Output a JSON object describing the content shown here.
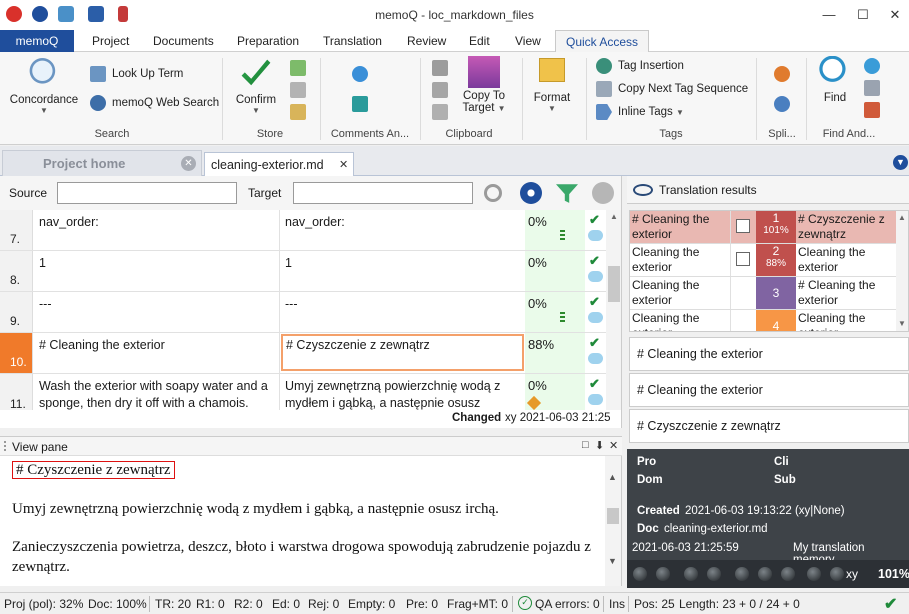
{
  "window": {
    "title": "memoQ - loc_markdown_files",
    "controls": [
      "—",
      "☐",
      "✕"
    ]
  },
  "ribbon_tabs": [
    "memoQ",
    "Project",
    "Documents",
    "Preparation",
    "Translation",
    "Review",
    "Edit",
    "View",
    "Quick Access"
  ],
  "ribbon": {
    "search": {
      "concordance": "Concordance",
      "look_up_term": "Look Up Term",
      "web_search": "memoQ Web Search",
      "label": "Search"
    },
    "store": {
      "confirm": "Confirm",
      "label": "Store"
    },
    "comments": {
      "label": "Comments An..."
    },
    "clipboard": {
      "copy_to_target_1": "Copy To",
      "copy_to_target_2": "Target",
      "label": "Clipboard"
    },
    "format": {
      "format": "Format"
    },
    "tags": {
      "tag_insertion": "Tag Insertion",
      "copy_next_tag": "Copy Next Tag Sequence",
      "inline_tags": "Inline Tags",
      "label": "Tags"
    },
    "split": {
      "label": "Spli..."
    },
    "find": {
      "find": "Find",
      "label": "Find And..."
    }
  },
  "doc_tabs": {
    "home": "Project home",
    "document": "cleaning-exterior.md"
  },
  "filter": {
    "source_label": "Source",
    "target_label": "Target",
    "source_value": "",
    "target_value": ""
  },
  "grid": {
    "rows": [
      {
        "num": "7.",
        "source": "nav_order:",
        "target": "nav_order:",
        "match": "0%"
      },
      {
        "num": "8.",
        "source": "1",
        "target": "1",
        "match": "0%"
      },
      {
        "num": "9.",
        "source": "---",
        "target": "---",
        "match": "0%"
      },
      {
        "num": "10.",
        "source": "# Cleaning the exterior",
        "target": "# Czyszczenie z zewnątrz",
        "match": "88%"
      },
      {
        "num": "11.",
        "source": "Wash the exterior with soapy water and a sponge, then dry it off with a chamois.",
        "target": "Umyj zewnętrzną powierzchnię wodą z mydłem i gąbką, a następnie osusz",
        "match": "0%"
      }
    ],
    "changed_label": "Changed",
    "changed_info": "xy 2021-06-03 21:25"
  },
  "view_pane": {
    "title": "View pane",
    "controls": [
      "□",
      "⬇",
      "✕"
    ],
    "current": "# Czyszczenie z zewnątrz",
    "para1": "Umyj zewnętrzną powierzchnię wodą z mydłem i gąbką, a następnie osusz irchą.",
    "para2": "Zanieczyszczenia powietrza, deszcz, błoto i warstwa drogowa spowodują zabrudzenie pojazdu z zewnątrz."
  },
  "translation_results": {
    "title": "Translation results",
    "hits": [
      {
        "source": "# Cleaning the exterior",
        "num": "1",
        "pct": "101%",
        "target": "# Czyszczenie z zewnątrz",
        "color": "#c0504d"
      },
      {
        "source": "Cleaning the exterior",
        "num": "2",
        "pct": "88%",
        "target": "Cleaning the exterior",
        "color": "#c0504d"
      },
      {
        "source": "Cleaning the exterior",
        "num": "3",
        "pct": "",
        "target": "# Cleaning the exterior",
        "color": "#8064a2"
      },
      {
        "source": "Cleaning the exterior",
        "num": "4",
        "pct": "",
        "target": "Cleaning the exterior",
        "color": "#f79646"
      }
    ],
    "compare_source": "# Cleaning the exterior",
    "compare_match": "# Cleaning the exterior",
    "compare_target": "# Czyszczenie z zewnątrz"
  },
  "info_panel": {
    "pro": "Pro",
    "cli": "Cli",
    "dom": "Dom",
    "sub": "Sub",
    "created_label": "Created",
    "created_value": "2021-06-03 19:13:22 (xy|None)",
    "doc_label": "Doc",
    "doc_value": "cleaning-exterior.md",
    "modified": "2021-06-03 21:25:59",
    "tm_name": "My translation memory",
    "user": "xy",
    "percent": "101%"
  },
  "status_bar": {
    "proj": "Proj (pol): 32%",
    "doc": "Doc: 100%",
    "tr": "TR: 20",
    "r1": "R1: 0",
    "r2": "R2: 0",
    "ed": "Ed: 0",
    "rej": "Rej: 0",
    "empty": "Empty: 0",
    "pre": "Pre: 0",
    "fragmt": "Frag+MT: 0",
    "qa": "QA errors: 0",
    "ins": "Ins",
    "pos": "Pos: 25",
    "length": "Length: 23 + 0 / 24 + 0"
  },
  "colors": {
    "brand": "#1f4e9c",
    "current_row": "#f07a2a",
    "match_bg": "#eafbea"
  }
}
